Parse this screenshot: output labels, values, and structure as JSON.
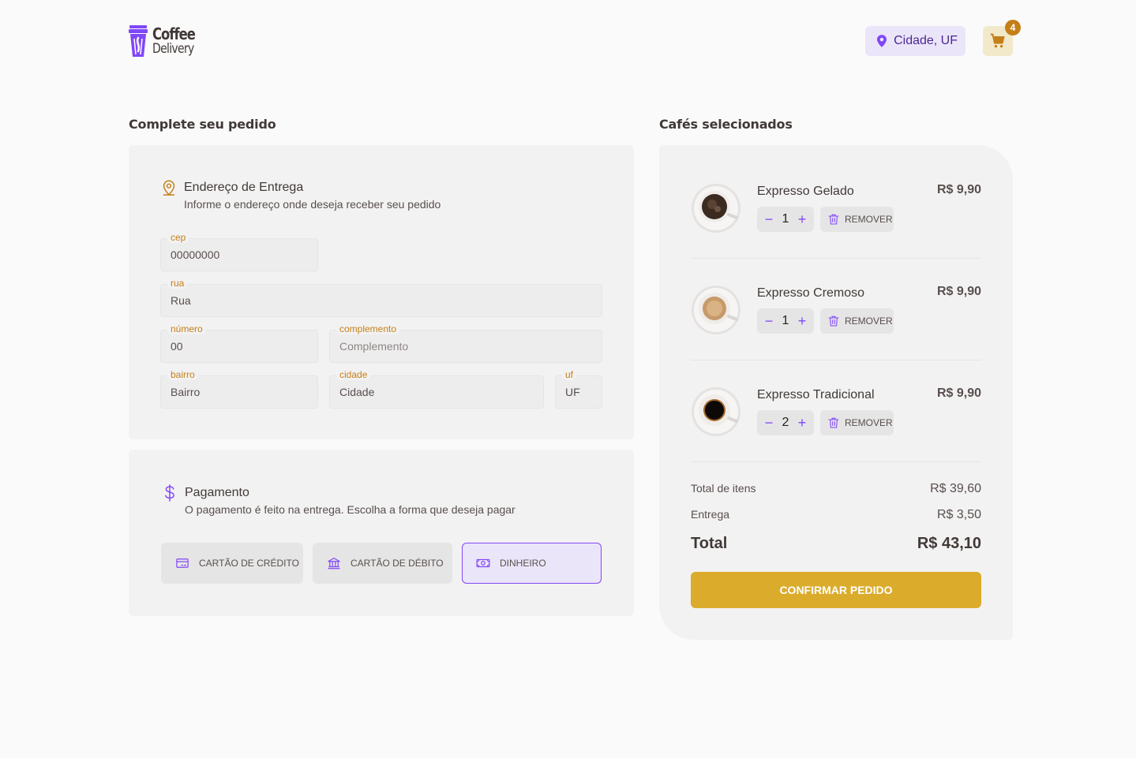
{
  "brand": {
    "line1": "Coffee",
    "line2": "Delivery"
  },
  "header": {
    "location": "Cidade, UF",
    "cart_count": "4"
  },
  "order": {
    "title": "Complete seu pedido",
    "address": {
      "title": "Endereço de Entrega",
      "subtitle": "Informe o endereço onde deseja receber seu pedido",
      "fields": {
        "cep": {
          "label": "cep",
          "value": "00000000",
          "placeholder": "CEP"
        },
        "rua": {
          "label": "rua",
          "value": "Rua",
          "placeholder": "Rua"
        },
        "numero": {
          "label": "número",
          "value": "00",
          "placeholder": "Número"
        },
        "complemento": {
          "label": "complemento",
          "value": "",
          "placeholder": "Complemento"
        },
        "bairro": {
          "label": "bairro",
          "value": "Bairro",
          "placeholder": "Bairro"
        },
        "cidade": {
          "label": "cidade",
          "value": "Cidade",
          "placeholder": "Cidade"
        },
        "uf": {
          "label": "uf",
          "value": "UF",
          "placeholder": "UF"
        }
      }
    },
    "payment": {
      "title": "Pagamento",
      "subtitle": "O pagamento é feito na entrega. Escolha a forma que deseja pagar",
      "options": [
        {
          "label": "CARTÃO DE CRÉDITO",
          "icon": "credit-card-icon",
          "selected": false
        },
        {
          "label": "CARTÃO DE DÉBITO",
          "icon": "bank-icon",
          "selected": false
        },
        {
          "label": "DINHEIRO",
          "icon": "money-icon",
          "selected": true
        }
      ]
    }
  },
  "cart": {
    "title": "Cafés selecionados",
    "items": [
      {
        "name": "Expresso Gelado",
        "price": "R$ 9,90",
        "qty": "1",
        "remove": "REMOVER"
      },
      {
        "name": "Expresso Cremoso",
        "price": "R$ 9,90",
        "qty": "1",
        "remove": "REMOVER"
      },
      {
        "name": "Expresso Tradicional",
        "price": "R$ 9,90",
        "qty": "2",
        "remove": "REMOVER"
      }
    ],
    "summary": {
      "items_label": "Total de itens",
      "items_value": "R$ 39,60",
      "delivery_label": "Entrega",
      "delivery_value": "R$ 3,50",
      "total_label": "Total",
      "total_value": "R$ 43,10"
    },
    "confirm_label": "CONFIRMAR PEDIDO"
  },
  "colors": {
    "purple": "#8047f8",
    "purple_dark": "#4b2995",
    "yellow": "#dbac2c",
    "yellow_dark": "#c47f17"
  }
}
